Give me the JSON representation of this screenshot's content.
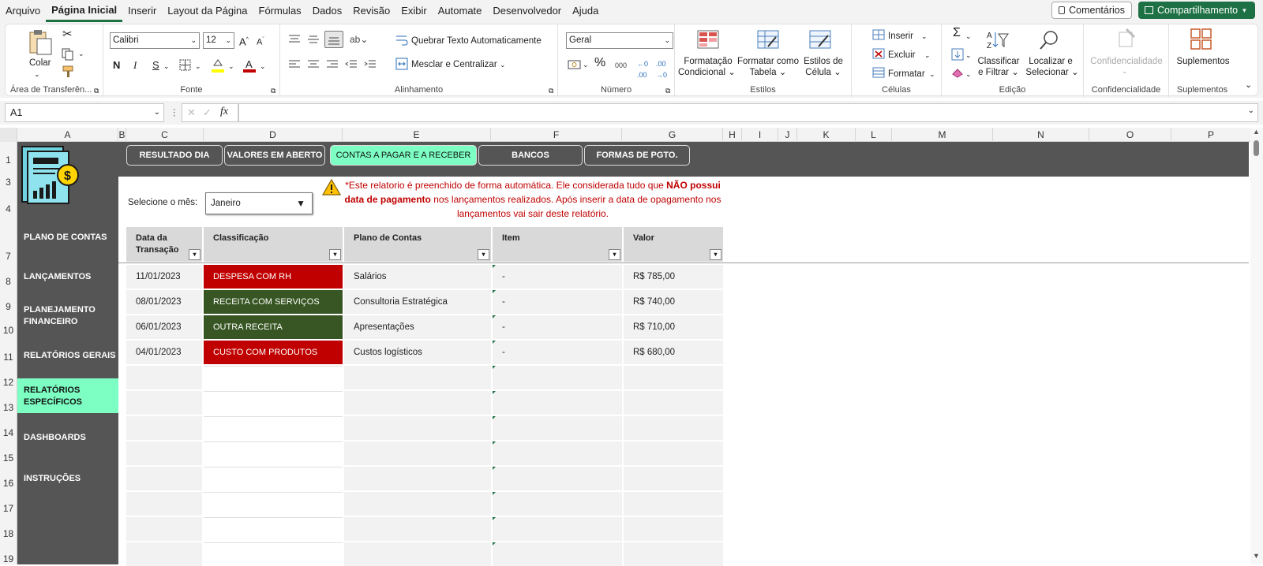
{
  "menu": [
    "Arquivo",
    "Página Inicial",
    "Inserir",
    "Layout da Página",
    "Fórmulas",
    "Dados",
    "Revisão",
    "Exibir",
    "Automate",
    "Desenvolvedor",
    "Ajuda"
  ],
  "buttons": {
    "comments": "Comentários",
    "share": "Compartilhamento"
  },
  "ribbon": {
    "paste_label": "Colar",
    "clipboard_title": "Área de Transferên...",
    "font_name": "Calibri",
    "font_size": "12",
    "font_title": "Fonte",
    "bold": "N",
    "italic": "I",
    "underline": "S",
    "wrap_text": "Quebrar Texto Automaticamente",
    "merge_center": "Mesclar e Centralizar",
    "alignment_title": "Alinhamento",
    "number_format": "Geral",
    "number_title": "Número",
    "cond_format": "Formatação\nCondicional",
    "cond_format_l1": "Formatação",
    "cond_format_l2": "Condicional",
    "table_format_l1": "Formatar como",
    "table_format_l2": "Tabela",
    "cell_styles_l1": "Estilos de",
    "cell_styles_l2": "Célula",
    "styles_title": "Estilos",
    "insert": "Inserir",
    "delete": "Excluir",
    "format": "Formatar",
    "cells_title": "Células",
    "sort_l1": "Classificar",
    "sort_l2": "e Filtrar",
    "find_l1": "Localizar e",
    "find_l2": "Selecionar",
    "editing_title": "Edição",
    "sensitivity": "Confidencialidade",
    "sensitivity_title": "Confidencialidade",
    "addins": "Suplementos",
    "addins_title": "Suplementos"
  },
  "formula_bar": {
    "name_box": "A1",
    "fx": "fx"
  },
  "columns": [
    "A",
    "B",
    "C",
    "D",
    "E",
    "F",
    "G",
    "H",
    "I",
    "J",
    "K",
    "L",
    "M",
    "N",
    "O",
    "P"
  ],
  "rows": [
    "1",
    "3",
    "4",
    "7",
    "8",
    "9",
    "10",
    "11",
    "12",
    "13",
    "14",
    "15",
    "16",
    "17",
    "18",
    "19"
  ],
  "sidebar": [
    "PLANO DE CONTAS",
    "LANÇAMENTOS",
    "PLANEJAMENTO FINANCEIRO",
    "RELATÓRIOS GERAIS",
    "RELATÓRIOS ESPECÍFICOS",
    "DASHBOARDS",
    "INSTRUÇÕES"
  ],
  "tabs": [
    "RESULTADO DIA",
    "VALORES EM ABERTO",
    "CONTAS A PAGAR E A RECEBER",
    "BANCOS",
    "FORMAS DE PGTO."
  ],
  "month_label": "Selecione o mês:",
  "month_value": "Janeiro",
  "warning": {
    "part1": "*Este relatorio é preenchido de forma automática. Ele considerada tudo que ",
    "bold1": "NÃO possui data de pagamento",
    "part2": " nos lançamentos realizados. Após inserir a data de opagamento nos lançamentos vai sair deste relatório."
  },
  "table": {
    "headers": [
      "Data da Transação",
      "Classificação",
      "Plano de Contas",
      "Item",
      "Valor"
    ],
    "rows": [
      {
        "date": "11/01/2023",
        "class": "DESPESA COM RH",
        "plan": "Salários",
        "item": "-",
        "value": "R$ 785,00"
      },
      {
        "date": "08/01/2023",
        "class": "RECEITA COM SERVIÇOS",
        "plan": "Consultoria Estratégica",
        "item": "-",
        "value": "R$ 740,00"
      },
      {
        "date": "06/01/2023",
        "class": "OUTRA RECEITA",
        "plan": "Apresentações",
        "item": "-",
        "value": "R$ 710,00"
      },
      {
        "date": "04/01/2023",
        "class": "CUSTO COM PRODUTOS",
        "plan": "Custos logísticos",
        "item": "-",
        "value": "R$ 680,00"
      }
    ]
  },
  "colors": {
    "expense": "#c00000",
    "income": "#375623",
    "accent": "#7dffc4",
    "dark": "#555555",
    "excel_green": "#1e7145"
  }
}
